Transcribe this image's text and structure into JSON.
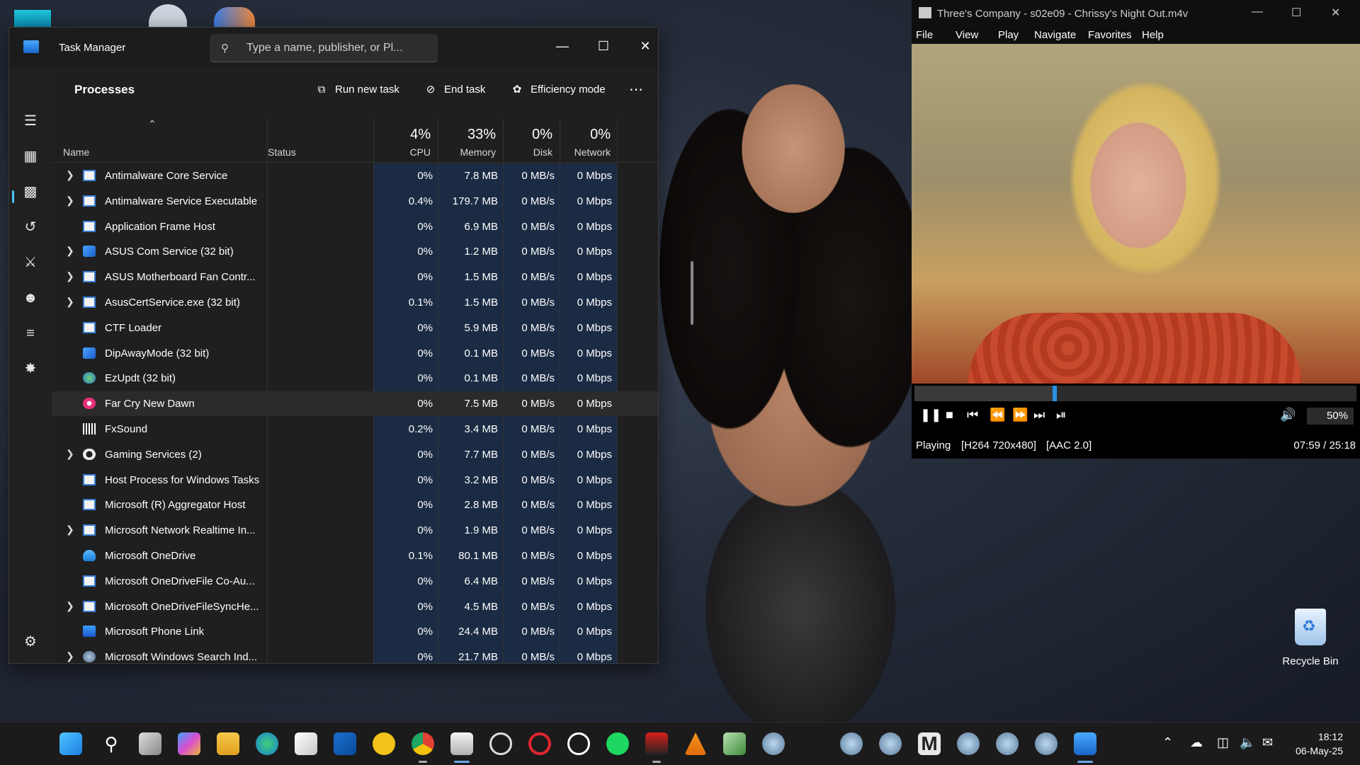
{
  "task_manager": {
    "title": "Task Manager",
    "search_placeholder": "Type a name, publisher, or Pl...",
    "heading": "Processes",
    "toolbar": {
      "run_new_task": "Run new task",
      "end_task": "End task",
      "efficiency_mode": "Efficiency mode"
    },
    "columns": {
      "name": "Name",
      "status": "Status",
      "cpu_pct": "4%",
      "cpu": "CPU",
      "memory_pct": "33%",
      "memory": "Memory",
      "disk_pct": "0%",
      "disk": "Disk",
      "network_pct": "0%",
      "network": "Network"
    },
    "rows": [
      {
        "name": "Antimalware Core Service",
        "cpu": "0%",
        "mem": "7.8 MB",
        "disk": "0 MB/s",
        "net": "0 Mbps",
        "expand": true,
        "icon": "app-window-icon"
      },
      {
        "name": "Antimalware Service Executable",
        "cpu": "0.4%",
        "mem": "179.7 MB",
        "disk": "0 MB/s",
        "net": "0 Mbps",
        "expand": true,
        "icon": "app-window-icon"
      },
      {
        "name": "Application Frame Host",
        "cpu": "0%",
        "mem": "6.9 MB",
        "disk": "0 MB/s",
        "net": "0 Mbps",
        "expand": false,
        "icon": "app-window-icon"
      },
      {
        "name": "ASUS Com Service (32 bit)",
        "cpu": "0%",
        "mem": "1.2 MB",
        "disk": "0 MB/s",
        "net": "0 Mbps",
        "expand": true,
        "icon": "blue-cube-icon"
      },
      {
        "name": "ASUS Motherboard Fan Contr...",
        "cpu": "0%",
        "mem": "1.5 MB",
        "disk": "0 MB/s",
        "net": "0 Mbps",
        "expand": true,
        "icon": "app-window-icon"
      },
      {
        "name": "AsusCertService.exe (32 bit)",
        "cpu": "0.1%",
        "mem": "1.5 MB",
        "disk": "0 MB/s",
        "net": "0 Mbps",
        "expand": true,
        "icon": "app-window-icon"
      },
      {
        "name": "CTF Loader",
        "cpu": "0%",
        "mem": "5.9 MB",
        "disk": "0 MB/s",
        "net": "0 Mbps",
        "expand": false,
        "icon": "app-window-icon"
      },
      {
        "name": "DipAwayMode (32 bit)",
        "cpu": "0%",
        "mem": "0.1 MB",
        "disk": "0 MB/s",
        "net": "0 Mbps",
        "expand": false,
        "icon": "blue-cube-icon"
      },
      {
        "name": "EzUpdt (32 bit)",
        "cpu": "0%",
        "mem": "0.1 MB",
        "disk": "0 MB/s",
        "net": "0 Mbps",
        "expand": false,
        "icon": "globe-icon"
      },
      {
        "name": "Far Cry New Dawn",
        "cpu": "0%",
        "mem": "7.5 MB",
        "disk": "0 MB/s",
        "net": "0 Mbps",
        "expand": false,
        "icon": "pink-flower-icon",
        "highlight": true
      },
      {
        "name": "FxSound",
        "cpu": "0.2%",
        "mem": "3.4 MB",
        "disk": "0 MB/s",
        "net": "0 Mbps",
        "expand": false,
        "icon": "sound-bars-icon"
      },
      {
        "name": "Gaming Services (2)",
        "cpu": "0%",
        "mem": "7.7 MB",
        "disk": "0 MB/s",
        "net": "0 Mbps",
        "expand": true,
        "icon": "xbox-icon"
      },
      {
        "name": "Host Process for Windows Tasks",
        "cpu": "0%",
        "mem": "3.2 MB",
        "disk": "0 MB/s",
        "net": "0 Mbps",
        "expand": false,
        "icon": "app-window-icon"
      },
      {
        "name": "Microsoft (R) Aggregator Host",
        "cpu": "0%",
        "mem": "2.8 MB",
        "disk": "0 MB/s",
        "net": "0 Mbps",
        "expand": false,
        "icon": "app-window-icon"
      },
      {
        "name": "Microsoft Network Realtime In...",
        "cpu": "0%",
        "mem": "1.9 MB",
        "disk": "0 MB/s",
        "net": "0 Mbps",
        "expand": true,
        "icon": "app-window-icon"
      },
      {
        "name": "Microsoft OneDrive",
        "cpu": "0.1%",
        "mem": "80.1 MB",
        "disk": "0 MB/s",
        "net": "0 Mbps",
        "expand": false,
        "icon": "cloud-icon"
      },
      {
        "name": "Microsoft OneDriveFile Co-Au...",
        "cpu": "0%",
        "mem": "6.4 MB",
        "disk": "0 MB/s",
        "net": "0 Mbps",
        "expand": false,
        "icon": "app-window-icon"
      },
      {
        "name": "Microsoft OneDriveFileSyncHe...",
        "cpu": "0%",
        "mem": "4.5 MB",
        "disk": "0 MB/s",
        "net": "0 Mbps",
        "expand": true,
        "icon": "app-window-icon"
      },
      {
        "name": "Microsoft Phone Link",
        "cpu": "0%",
        "mem": "24.4 MB",
        "disk": "0 MB/s",
        "net": "0 Mbps",
        "expand": false,
        "icon": "phone-icon"
      },
      {
        "name": "Microsoft Windows Search Ind...",
        "cpu": "0%",
        "mem": "21.7 MB",
        "disk": "0 MB/s",
        "net": "0 Mbps",
        "expand": true,
        "icon": "search-indexer-icon"
      }
    ]
  },
  "media_player": {
    "title": "Three's Company - s02e09 - Chrissy's Night Out.m4v",
    "menu": [
      "File",
      "View",
      "Play",
      "Navigate",
      "Favorites",
      "Help"
    ],
    "volume": "50%",
    "seek_fraction": 0.318,
    "status": "Playing",
    "video_info": "[H264 720x480]",
    "audio_info": "[AAC 2.0]",
    "time": "07:59 / 25:18"
  },
  "desktop": {
    "recycle_bin": "Recycle Bin"
  },
  "taskbar": {
    "time": "18:12",
    "date": "06-May-25"
  },
  "colors": {
    "accent": "#4cc2ff",
    "cpu_band": "#1b2b44",
    "seek_knob": "#2a90e0"
  }
}
